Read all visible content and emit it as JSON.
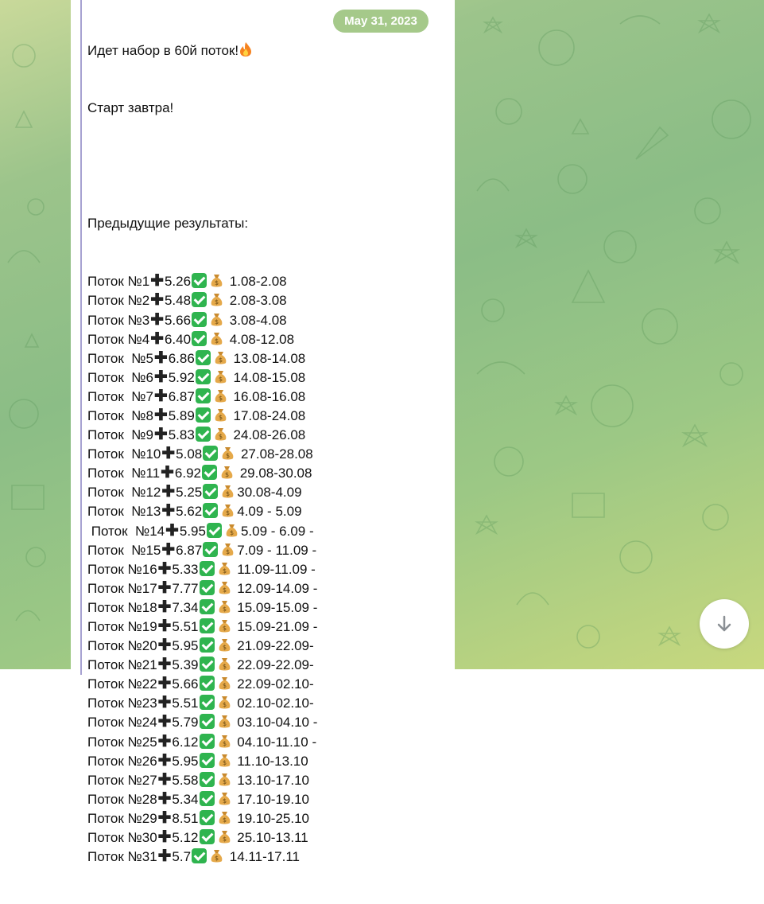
{
  "message": {
    "intro": [
      "Идет набор в 60й поток!",
      "Старт завтра!",
      "",
      "Предыдущие результаты:"
    ],
    "flame_icon": "fire-emoji",
    "date": "May 31, 2023",
    "results": [
      {
        "prefix": "Поток №1",
        "value": "5.26",
        "range": " 1.08-2.08"
      },
      {
        "prefix": "Поток №2",
        "value": "5.48",
        "range": " 2.08-3.08"
      },
      {
        "prefix": "Поток №3",
        "value": "5.66",
        "range": " 3.08-4.08"
      },
      {
        "prefix": "Поток №4",
        "value": "6.40",
        "range": " 4.08-12.08"
      },
      {
        "prefix": "Поток  №5",
        "value": "6.86",
        "range": " 13.08-14.08"
      },
      {
        "prefix": "Поток  №6",
        "value": "5.92",
        "range": " 14.08-15.08"
      },
      {
        "prefix": "Поток  №7",
        "value": "6.87",
        "range": " 16.08-16.08"
      },
      {
        "prefix": "Поток  №8",
        "value": "5.89",
        "range": " 17.08-24.08"
      },
      {
        "prefix": "Поток  №9",
        "value": "5.83",
        "range": " 24.08-26.08"
      },
      {
        "prefix": "Поток  №10",
        "value": "5.08",
        "range": " 27.08-28.08"
      },
      {
        "prefix": "Поток  №11",
        "value": "6.92",
        "range": " 29.08-30.08"
      },
      {
        "prefix": "Поток  №12",
        "value": "5.25",
        "range": "30.08-4.09"
      },
      {
        "prefix": "Поток  №13",
        "value": "5.62",
        "range": "4.09 - 5.09"
      },
      {
        "prefix": " Поток  №14",
        "value": "5.95",
        "range": "5.09 - 6.09 -"
      },
      {
        "prefix": "Поток  №15",
        "value": "6.87",
        "range": "7.09 - 11.09 -"
      },
      {
        "prefix": "Поток №16",
        "value": "5.33",
        "range": " 11.09-11.09 -"
      },
      {
        "prefix": "Поток №17",
        "value": "7.77",
        "range": " 12.09-14.09 -"
      },
      {
        "prefix": "Поток №18",
        "value": "7.34",
        "range": " 15.09-15.09 -"
      },
      {
        "prefix": "Поток №19",
        "value": "5.51",
        "range": " 15.09-21.09 -"
      },
      {
        "prefix": "Поток №20",
        "value": "5.95",
        "range": " 21.09-22.09-"
      },
      {
        "prefix": "Поток №21",
        "value": "5.39",
        "range": " 22.09-22.09-"
      },
      {
        "prefix": "Поток №22",
        "value": "5.66",
        "range": " 22.09-02.10-"
      },
      {
        "prefix": "Поток №23",
        "value": "5.51",
        "range": " 02.10-02.10-"
      },
      {
        "prefix": "Поток №24",
        "value": "5.79",
        "range": " 03.10-04.10 -"
      },
      {
        "prefix": "Поток №25",
        "value": "6.12",
        "range": " 04.10-11.10 -"
      },
      {
        "prefix": "Поток №26",
        "value": "5.95",
        "range": " 11.10-13.10"
      },
      {
        "prefix": "Поток №27",
        "value": "5.58",
        "range": " 13.10-17.10"
      },
      {
        "prefix": "Поток №28",
        "value": "5.34",
        "range": " 17.10-19.10"
      },
      {
        "prefix": "Поток №29",
        "value": "8.51",
        "range": " 19.10-25.10"
      },
      {
        "prefix": "Поток №30",
        "value": "5.12",
        "range": " 25.10-13.11"
      },
      {
        "prefix": "Поток №31",
        "value": "5.7",
        "range": " 14.11-17.11"
      }
    ]
  },
  "scroll_button": {
    "icon": "arrow-down-icon"
  },
  "colors": {
    "check": "#2fb44f",
    "date_badge": "#a5c98a",
    "quote_bar": "#a7a2d1"
  }
}
